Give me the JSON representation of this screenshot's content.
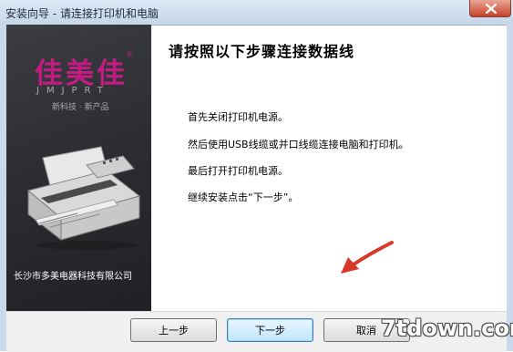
{
  "window": {
    "title": "安装向导 - 请连接打印机和电脑"
  },
  "brand": {
    "name_cn": "佳美佳",
    "registered_mark": "®",
    "name_en": "JMJPRT",
    "slogan": "新科技 · 新产品",
    "company": "长沙市多美电器科技有限公司"
  },
  "content": {
    "heading": "请按照以下步骤连接数据线",
    "steps": [
      "首先关闭打印机电源。",
      "然后使用USB线缆或并口线缆连接电脑和打印机。",
      "最后打开打印机电源。",
      "继续安装点击“下一步”。"
    ]
  },
  "footer": {
    "prev_label": "上一步",
    "next_label": "下一步",
    "cancel_label": "取消"
  },
  "watermark": "7tdown.com",
  "colors": {
    "brand_magenta": "#c21c82",
    "panel_dark": "#2a2b2f",
    "arrow_red": "#d8392b",
    "titlebar": "#c6d7ea"
  },
  "icons": {
    "close": "close-icon",
    "arrow": "red-arrow-icon",
    "printer": "printer-image"
  }
}
